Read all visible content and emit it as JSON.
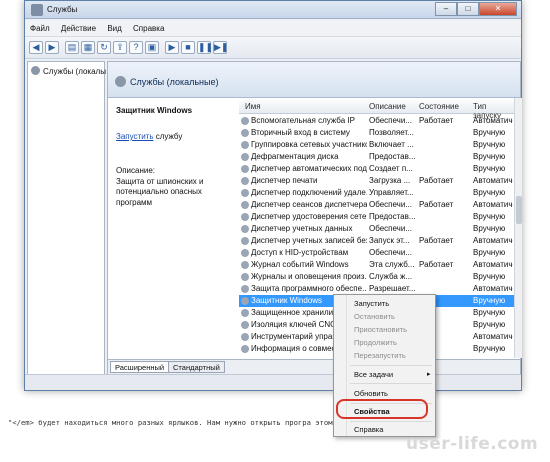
{
  "window": {
    "title": "Службы"
  },
  "menu": [
    "Файл",
    "Действие",
    "Вид",
    "Справка"
  ],
  "tree": {
    "label": "Службы (локалы"
  },
  "header": {
    "title": "Службы (локальные)"
  },
  "description": {
    "service_name": "Защитник Windows",
    "start_link": "Запустить",
    "start_suffix": " службу",
    "desc_label": "Описание:",
    "desc_text": "Защита от шпионских и потенциально опасных программ"
  },
  "columns": [
    "Имя",
    "Описание",
    "Состояние",
    "Тип запуску"
  ],
  "rows": [
    [
      "Вспомогательная служба IP",
      "Обеспечи...",
      "Работает",
      "Автоматиче..."
    ],
    [
      "Вторичный вход в систему",
      "Позволяет...",
      "",
      "Вручную"
    ],
    [
      "Группировка сетевых участников",
      "Включает ...",
      "",
      "Вручную"
    ],
    [
      "Дефрагментация диска",
      "Предостав...",
      "",
      "Вручную"
    ],
    [
      "Диспетчер автоматических под...",
      "Создает п...",
      "",
      "Вручную"
    ],
    [
      "Диспетчер печати",
      "Загрузка ...",
      "Работает",
      "Автоматиче..."
    ],
    [
      "Диспетчер подключений удале...",
      "Управляет...",
      "",
      "Вручную"
    ],
    [
      "Диспетчер сеансов диспетчера...",
      "Обеспечи...",
      "Работает",
      "Автоматиче..."
    ],
    [
      "Диспетчер удостоверения сете...",
      "Предостав...",
      "",
      "Вручную"
    ],
    [
      "Диспетчер учетных данных",
      "Обеспечи...",
      "",
      "Вручную"
    ],
    [
      "Диспетчер учетных записей без...",
      "Запуск эт...",
      "Работает",
      "Автоматиче..."
    ],
    [
      "Доступ к HID-устройствам",
      "Обеспечи...",
      "",
      "Вручную"
    ],
    [
      "Журнал событий Windows",
      "Эта служб...",
      "Работает",
      "Автоматиче..."
    ],
    [
      "Журналы и оповещения произ...",
      "Служба ж...",
      "",
      "Вручную"
    ],
    [
      "Защита программного обеспе...",
      "Разрешает...",
      "",
      "Автоматиче..."
    ],
    [
      "Защитник Windows",
      "",
      "",
      "Вручную"
    ],
    [
      "Защищенное хранилищ",
      "",
      "",
      "Вручную"
    ],
    [
      "Изоляция ключей CNG",
      "",
      "",
      "Вручную"
    ],
    [
      "Инструментарий управл",
      "",
      "",
      "Автоматиче..."
    ],
    [
      "Информация о совместе",
      "",
      "",
      "Вручную"
    ]
  ],
  "tabs": [
    "Расширенный",
    "Стандартный"
  ],
  "context_menu": {
    "start": "Запустить",
    "stop": "Остановить",
    "pause": "Приостановить",
    "resume": "Продолжить",
    "restart": "Перезапустить",
    "all_tasks": "Все задачи",
    "refresh": "Обновить",
    "properties": "Свойства",
    "help": "Справка"
  },
  "background_text": "\"</em> будет находиться много разных ярлыков. Нам нужно открыть програ                   этому нажимаем два р",
  "watermark": "user-life.com",
  "accent_color": "#3399ff",
  "highlight_color": "#d9362b"
}
